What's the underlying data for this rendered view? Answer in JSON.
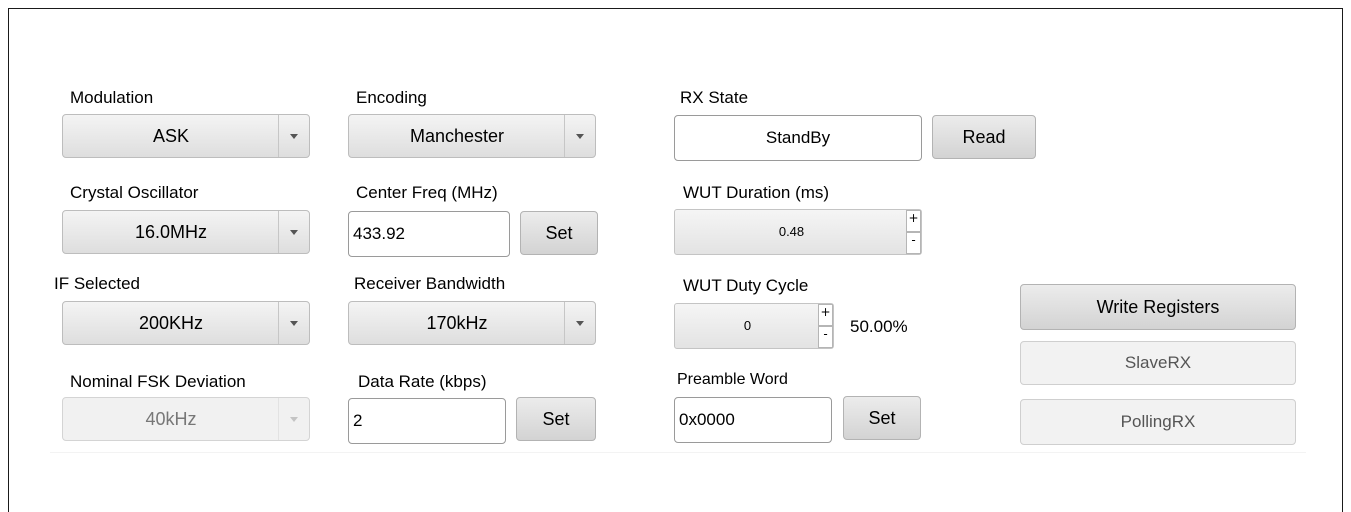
{
  "modulation": {
    "label": "Modulation",
    "value": "ASK"
  },
  "encoding": {
    "label": "Encoding",
    "value": "Manchester"
  },
  "rx_state": {
    "label": "RX State",
    "value": "StandBy",
    "button": "Read"
  },
  "crystal": {
    "label": "Crystal Oscillator",
    "value": "16.0MHz"
  },
  "center_freq": {
    "label": "Center Freq (MHz)",
    "value": "433.92",
    "button": "Set"
  },
  "wut_duration": {
    "label": "WUT Duration (ms)",
    "value": "0.48",
    "plus": "+",
    "minus": "-"
  },
  "if_selected": {
    "label": "IF Selected",
    "value": "200KHz"
  },
  "rx_bandwidth": {
    "label": "Receiver Bandwidth",
    "value": "170kHz"
  },
  "wut_duty": {
    "label": "WUT Duty Cycle",
    "value": "0",
    "plus": "+",
    "minus": "-",
    "percent": "50.00%"
  },
  "fsk_dev": {
    "label": "Nominal FSK Deviation",
    "value": "40kHz"
  },
  "data_rate": {
    "label": "Data Rate (kbps)",
    "value": "2",
    "button": "Set"
  },
  "preamble": {
    "label": "Preamble Word",
    "value": "0x0000",
    "button": "Set"
  },
  "actions": {
    "write": "Write Registers",
    "slave": "SlaveRX",
    "polling": "PollingRX"
  }
}
